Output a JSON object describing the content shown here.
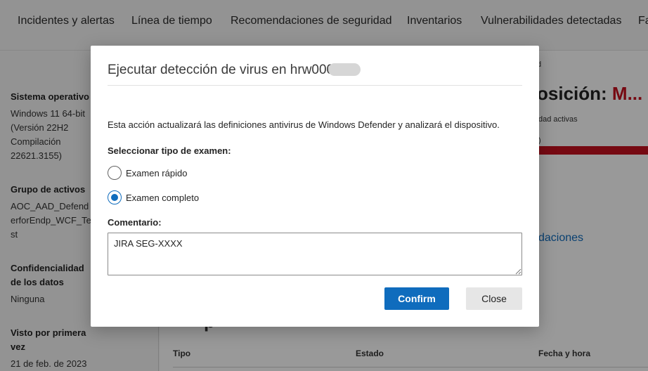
{
  "topnav": {
    "tabs": [
      "Incidentes y alertas",
      "Línea de tiempo",
      "Recomendaciones de seguridad",
      "Inventarios",
      "Vulnerabilidades detectadas",
      "Fa"
    ]
  },
  "sidebar": {
    "os": {
      "label": "Sistema operativo",
      "value": "Windows 11 64-bit\n(Versión 22H2\nCompilación\n22621.3155)"
    },
    "asset_group": {
      "label": "Grupo de activos",
      "value": "AOC_AAD_Defend\nerforEndp_WCF_Te\nst"
    },
    "confidentiality": {
      "label": "Confidencialidad\nde los datos",
      "value": "Ninguna"
    },
    "first_seen": {
      "label": "Visto por primera\nvez",
      "value": "21 de feb. de 2023"
    }
  },
  "background": {
    "right_small_1": "d",
    "exposure_prefix": "osición: ",
    "exposure_level": "M...",
    "right_small_2": "dad activas",
    "right_small_3": ")",
    "link": "daciones",
    "heading_fragment": "p",
    "table_headers": [
      "Tipo",
      "Estado",
      "Fecha y hora"
    ]
  },
  "dialog": {
    "title": "Ejecutar detección de virus en hrw000",
    "description": "Esta acción actualizará las definiciones antivirus de Windows Defender y analizará el dispositivo.",
    "scan_type_label": "Seleccionar tipo de examen:",
    "options": [
      {
        "label": "Examen rápido",
        "selected": false
      },
      {
        "label": "Examen completo",
        "selected": true
      }
    ],
    "comment_label": "Comentario:",
    "comment_value": "JIRA SEG-XXXX",
    "confirm_label": "Confirm",
    "close_label": "Close"
  },
  "colors": {
    "accent": "#0f6cbd",
    "danger": "#c50f1f"
  }
}
